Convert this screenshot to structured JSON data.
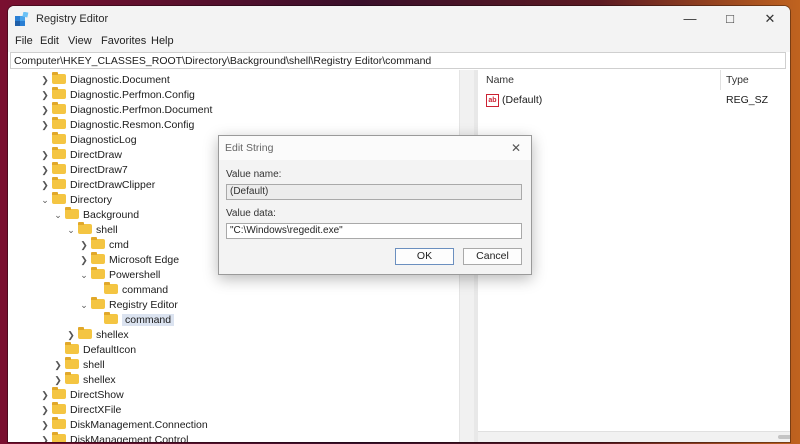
{
  "window": {
    "title": "Registry Editor",
    "app_icon": "registry-editor-icon",
    "minimize_glyph": "—",
    "maximize_glyph": "□",
    "close_glyph": "✕"
  },
  "menu": [
    "File",
    "Edit",
    "View",
    "Favorites",
    "Help"
  ],
  "address": "Computer\\HKEY_CLASSES_ROOT\\Directory\\Background\\shell\\Registry Editor\\command",
  "tree": [
    {
      "label": "Diagnostic.Document",
      "depth": 0,
      "chevron": "right"
    },
    {
      "label": "Diagnostic.Perfmon.Config",
      "depth": 0,
      "chevron": "right"
    },
    {
      "label": "Diagnostic.Perfmon.Document",
      "depth": 0,
      "chevron": "right"
    },
    {
      "label": "Diagnostic.Resmon.Config",
      "depth": 0,
      "chevron": "right"
    },
    {
      "label": "DiagnosticLog",
      "depth": 0,
      "chevron": "none"
    },
    {
      "label": "DirectDraw",
      "depth": 0,
      "chevron": "right"
    },
    {
      "label": "DirectDraw7",
      "depth": 0,
      "chevron": "right"
    },
    {
      "label": "DirectDrawClipper",
      "depth": 0,
      "chevron": "right"
    },
    {
      "label": "Directory",
      "depth": 0,
      "chevron": "down"
    },
    {
      "label": "Background",
      "depth": 1,
      "chevron": "down"
    },
    {
      "label": "shell",
      "depth": 2,
      "chevron": "down"
    },
    {
      "label": "cmd",
      "depth": 3,
      "chevron": "right"
    },
    {
      "label": "Microsoft Edge",
      "depth": 3,
      "chevron": "right"
    },
    {
      "label": "Powershell",
      "depth": 3,
      "chevron": "down"
    },
    {
      "label": "command",
      "depth": 4,
      "chevron": "none"
    },
    {
      "label": "Registry Editor",
      "depth": 3,
      "chevron": "down"
    },
    {
      "label": "command",
      "depth": 4,
      "chevron": "none",
      "selected": true
    },
    {
      "label": "shellex",
      "depth": 2,
      "chevron": "right"
    },
    {
      "label": "DefaultIcon",
      "depth": 1,
      "chevron": "none"
    },
    {
      "label": "shell",
      "depth": 1,
      "chevron": "right"
    },
    {
      "label": "shellex",
      "depth": 1,
      "chevron": "right"
    },
    {
      "label": "DirectShow",
      "depth": 0,
      "chevron": "right"
    },
    {
      "label": "DirectXFile",
      "depth": 0,
      "chevron": "right"
    },
    {
      "label": "DiskManagement.Connection",
      "depth": 0,
      "chevron": "right"
    },
    {
      "label": "DiskManagement.Control",
      "depth": 0,
      "chevron": "right"
    }
  ],
  "list": {
    "columns": [
      "Name",
      "Type"
    ],
    "rows": [
      {
        "name": "(Default)",
        "type": "REG_SZ",
        "icon": "string-value-icon"
      }
    ]
  },
  "dialog": {
    "title": "Edit String",
    "value_name_label": "Value name:",
    "value_name": "(Default)",
    "value_data_label": "Value data:",
    "value_data": "\"C:\\Windows\\regedit.exe\"",
    "ok_label": "OK",
    "cancel_label": "Cancel",
    "close_glyph": "✕"
  },
  "colors": {
    "folder": "#f4c542",
    "selection": "#dbe3f0",
    "desktop_left": "#7a1030",
    "desktop_right": "#c0631f"
  }
}
